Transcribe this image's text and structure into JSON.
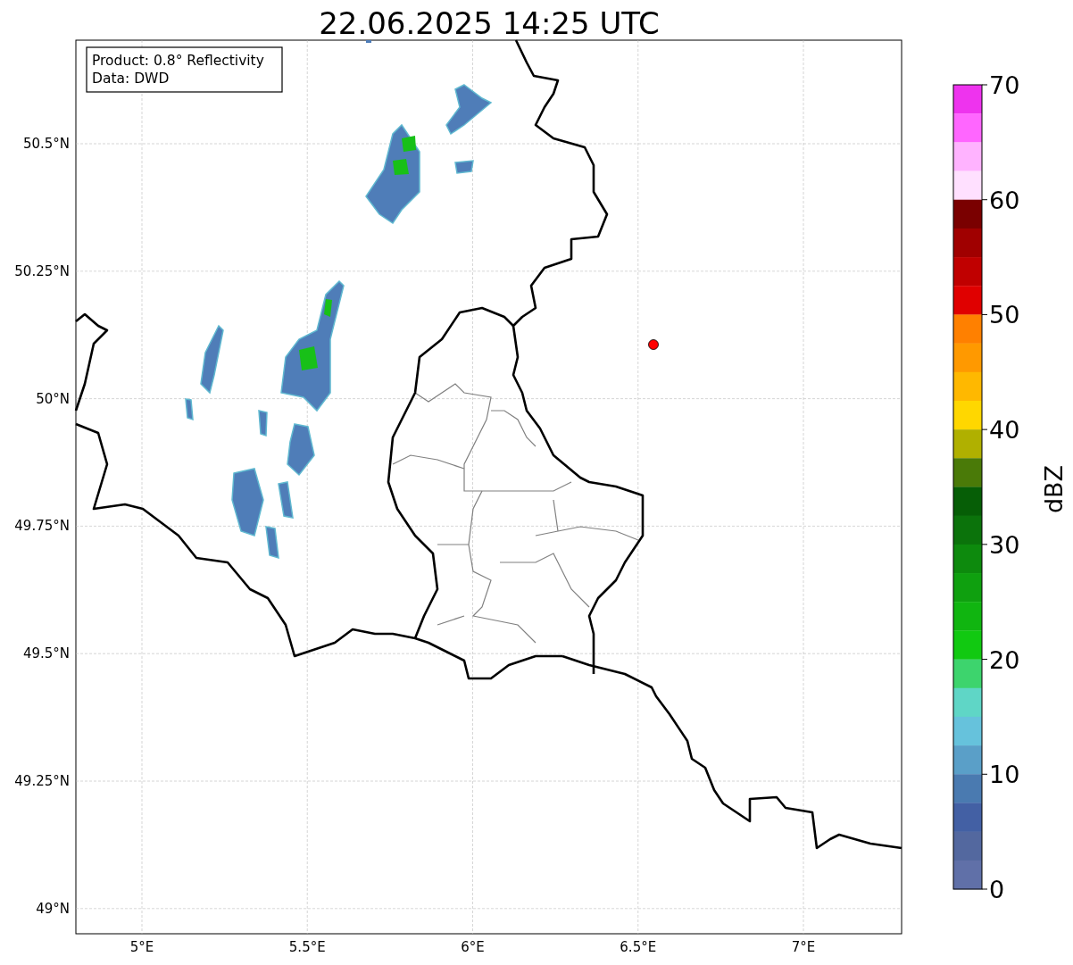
{
  "title": "22.06.2025 14:25 UTC",
  "info_box": [
    "Product: 0.8° Reflectivity",
    "Data: DWD"
  ],
  "map": {
    "lat_labels": [
      "50.5°N",
      "50.25°N",
      "50°N",
      "49.75°N",
      "49.5°N",
      "49.25°N",
      "49°N"
    ],
    "lon_labels": [
      "5°E",
      "5.5°E",
      "6°E",
      "6.5°E",
      "7°E"
    ]
  },
  "colorbar": {
    "label": "dBZ",
    "ticks": [
      "70",
      "60",
      "50",
      "40",
      "30",
      "20",
      "10",
      "0"
    ],
    "bins": [
      {
        "color": "#ee33ee"
      },
      {
        "color": "#ff66ff"
      },
      {
        "color": "#ffb3ff"
      },
      {
        "color": "#ffe0ff"
      },
      {
        "color": "#7a0000"
      },
      {
        "color": "#a00000"
      },
      {
        "color": "#c00000"
      },
      {
        "color": "#e00000"
      },
      {
        "color": "#ff8000"
      },
      {
        "color": "#ff9900"
      },
      {
        "color": "#ffb800"
      },
      {
        "color": "#ffd700"
      },
      {
        "color": "#b0b000"
      },
      {
        "color": "#4a7a08"
      },
      {
        "color": "#065e06"
      },
      {
        "color": "#0b730b"
      },
      {
        "color": "#0d8a0d"
      },
      {
        "color": "#0fa00f"
      },
      {
        "color": "#10b510"
      },
      {
        "color": "#11c911"
      },
      {
        "color": "#3dd46d"
      },
      {
        "color": "#5fd6c6"
      },
      {
        "color": "#66c2dc"
      },
      {
        "color": "#5a9fc8"
      },
      {
        "color": "#4a7ab0"
      },
      {
        "color": "#4360a4"
      },
      {
        "color": "#53689f"
      },
      {
        "color": "#6070a8"
      }
    ]
  }
}
